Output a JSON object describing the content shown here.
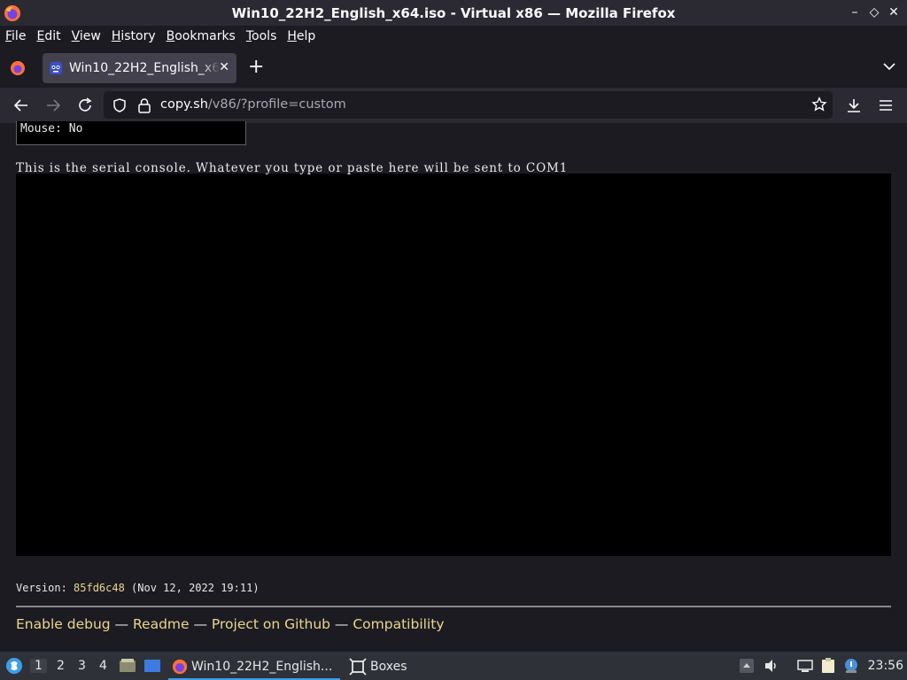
{
  "window": {
    "title": "Win10_22H2_English_x64.iso - Virtual x86 — Mozilla Firefox",
    "buttons": [
      "minimize",
      "maximize",
      "close"
    ]
  },
  "menubar": {
    "items": [
      {
        "label": "File",
        "mnemonic": "F",
        "rest": "ile"
      },
      {
        "label": "Edit",
        "mnemonic": "E",
        "rest": "dit"
      },
      {
        "label": "View",
        "mnemonic": "V",
        "rest": "iew"
      },
      {
        "label": "History",
        "mnemonic": "H",
        "rest": "istory"
      },
      {
        "label": "Bookmarks",
        "mnemonic": "B",
        "rest": "ookmarks"
      },
      {
        "label": "Tools",
        "mnemonic": "T",
        "rest": "ools"
      },
      {
        "label": "Help",
        "mnemonic": "H",
        "rest": "elp"
      }
    ]
  },
  "tabs": {
    "active": {
      "title": "Win10_22H2_English_x64.iso - Virtual x86"
    }
  },
  "navbar": {
    "url_domain": "copy.sh",
    "url_path": "/v86/?profile=custom"
  },
  "content": {
    "mouse_status": "Mouse: No",
    "serial_text": "This is the serial console. Whatever you type or paste here will be sent to COM1",
    "version_label": "Version: ",
    "version_hash": "85fd6c48",
    "version_date": " (Nov 12, 2022 19:11)",
    "links": [
      "Enable debug",
      "Readme",
      "Project on Github",
      "Compatibility"
    ],
    "link_separator": " — "
  },
  "taskbar": {
    "workspaces": [
      "1",
      "2",
      "3",
      "4"
    ],
    "active_workspace": "1",
    "firefox_item": "Win10_22H2_English...",
    "boxes_item": "Boxes",
    "clock": "23:56"
  },
  "colors": {
    "accent_link": "#e9d68d",
    "taskbar_active": "#3d9ee8"
  }
}
